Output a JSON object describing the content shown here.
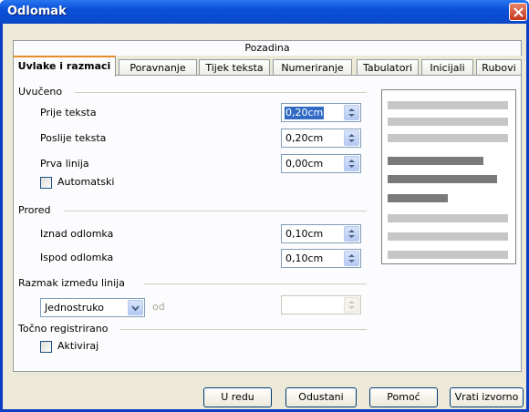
{
  "window": {
    "title": "Odlomak"
  },
  "tabs": {
    "top_row": [
      "Pozadina"
    ],
    "bottom_row": [
      "Uvlake i razmaci",
      "Poravnanje",
      "Tijek teksta",
      "Numeriranje",
      "Tabulatori",
      "Inicijali",
      "Rubovi"
    ],
    "active": "Uvlake i razmaci"
  },
  "indent": {
    "header": "Uvučeno",
    "before_label": "Prije teksta",
    "before_value": "0,20cm",
    "after_label": "Poslije teksta",
    "after_value": "0,20cm",
    "first_line_label": "Prva linija",
    "first_line_value": "0,00cm",
    "automatic_label": "Automatski",
    "automatic_checked": false
  },
  "spacing": {
    "header": "Prored",
    "above_label": "Iznad odlomka",
    "above_value": "0,10cm",
    "below_label": "Ispod odlomka",
    "below_value": "0,10cm"
  },
  "line_spacing": {
    "header": "Razmak između linija",
    "selected": "Jednostruko",
    "of_label": "od",
    "of_value": ""
  },
  "register": {
    "header": "Točno registrirano",
    "activate_label": "Aktiviraj",
    "activate_checked": false
  },
  "buttons": {
    "ok": "U redu",
    "cancel": "Odustani",
    "help": "Pomoć",
    "reset": "Vrati izvorno"
  },
  "colors": {
    "accent_tab": "#e68b2c",
    "titlebar": "#0a50d8",
    "preview_light": "#c6c6c6",
    "preview_dark": "#7a7a7a"
  },
  "icons": [
    "close-icon",
    "spin-arrows-icon",
    "dropdown-arrow-icon"
  ]
}
